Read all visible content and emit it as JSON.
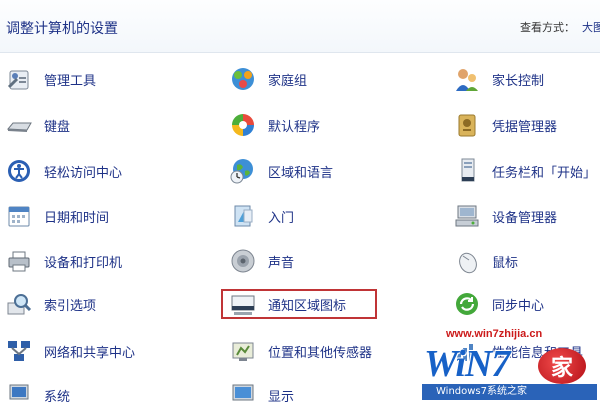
{
  "header": {
    "title": "调整计算机的设置",
    "view_by_label": "查看方式：",
    "view_by_value": "大图"
  },
  "items": [
    {
      "label": "管理工具",
      "icon": "admin-tools-icon"
    },
    {
      "label": "家庭组",
      "icon": "homegroup-icon"
    },
    {
      "label": "家长控制",
      "icon": "parental-controls-icon"
    },
    {
      "label": "键盘",
      "icon": "keyboard-icon"
    },
    {
      "label": "默认程序",
      "icon": "default-programs-icon"
    },
    {
      "label": "凭据管理器",
      "icon": "credential-manager-icon"
    },
    {
      "label": "轻松访问中心",
      "icon": "ease-of-access-icon"
    },
    {
      "label": "区域和语言",
      "icon": "region-language-icon"
    },
    {
      "label": "任务栏和「开始」",
      "icon": "taskbar-start-icon"
    },
    {
      "label": "日期和时间",
      "icon": "date-time-icon"
    },
    {
      "label": "入门",
      "icon": "getting-started-icon"
    },
    {
      "label": "设备管理器",
      "icon": "device-manager-icon"
    },
    {
      "label": "设备和打印机",
      "icon": "devices-printers-icon"
    },
    {
      "label": "声音",
      "icon": "sound-icon"
    },
    {
      "label": "鼠标",
      "icon": "mouse-icon"
    },
    {
      "label": "索引选项",
      "icon": "indexing-options-icon"
    },
    {
      "label": "通知区域图标",
      "icon": "notification-area-icon"
    },
    {
      "label": "同步中心",
      "icon": "sync-center-icon"
    },
    {
      "label": "网络和共享中心",
      "icon": "network-sharing-icon"
    },
    {
      "label": "位置和其他传感器",
      "icon": "location-sensors-icon"
    },
    {
      "label": "性能信息和工具",
      "icon": "performance-icon"
    },
    {
      "label": "系统",
      "icon": "system-icon"
    },
    {
      "label": "显示",
      "icon": "display-icon"
    }
  ],
  "watermark": {
    "url": "www.win7zhijia.cn",
    "logo": "WiN7",
    "badge": "家",
    "tag": "Windows7系统之家"
  },
  "colors": {
    "link": "#1e3287",
    "highlight_border": "#c03436"
  }
}
